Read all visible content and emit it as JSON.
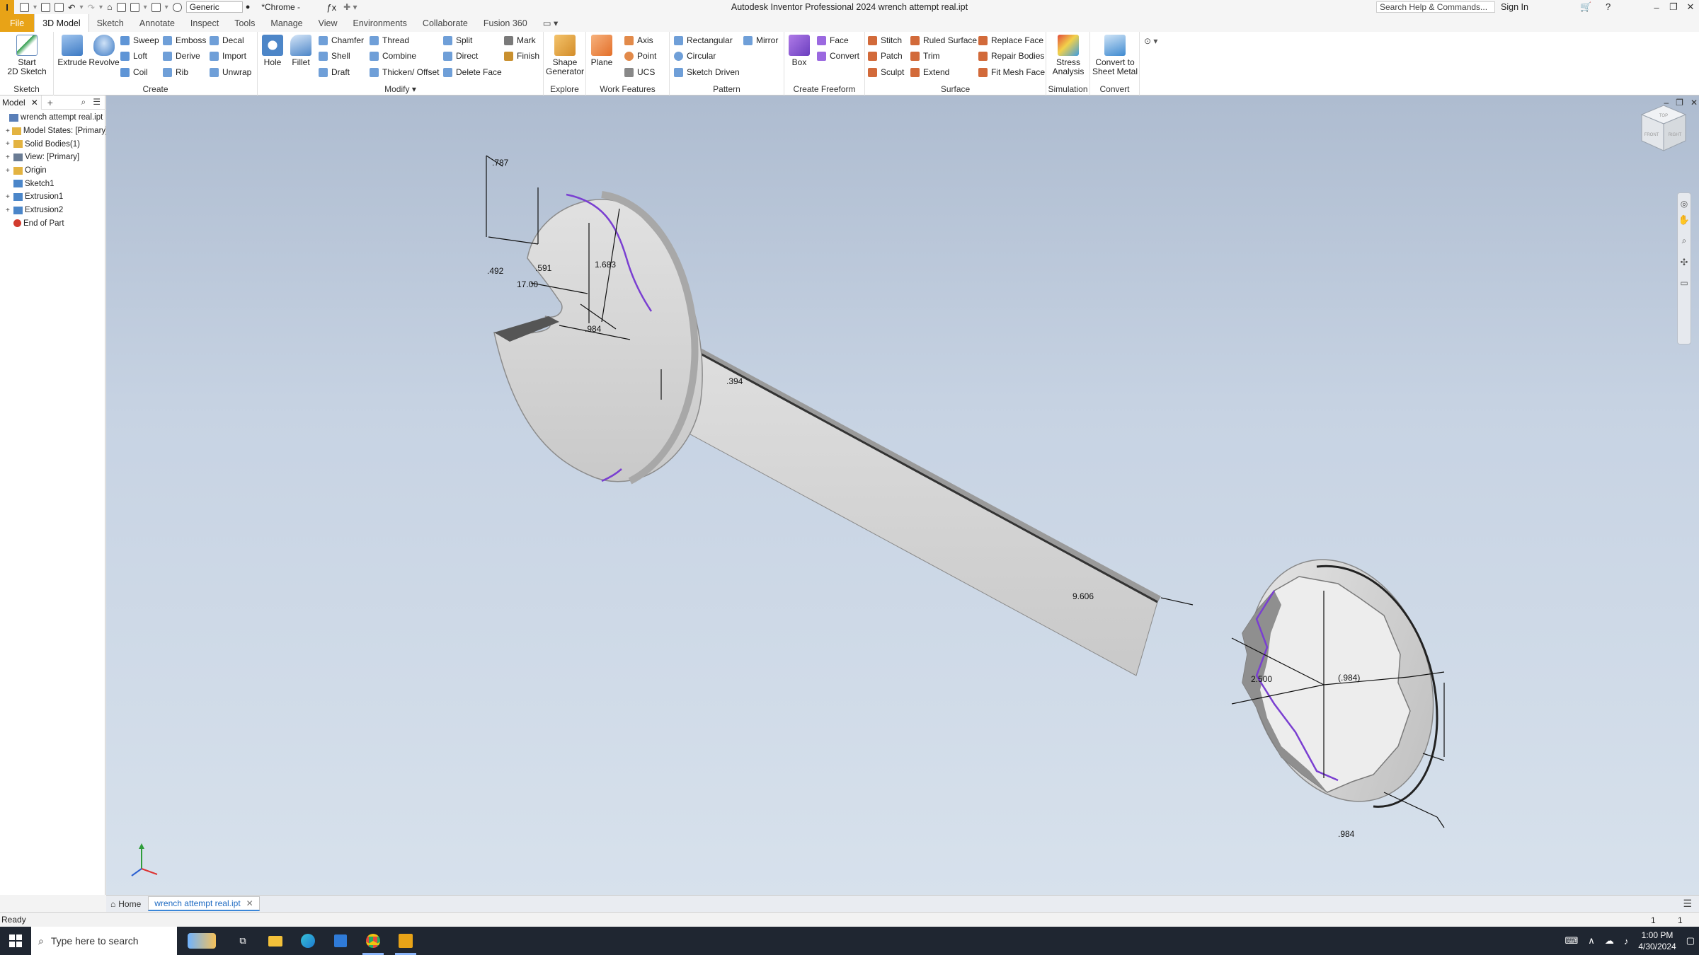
{
  "window": {
    "title": "Autodesk Inventor Professional 2024   wrench attempt real.ipt",
    "search_placeholder": "Search Help & Commands...",
    "sign_in": "Sign In",
    "appearance": "Generic",
    "browser_theme": "*Chrome -"
  },
  "menu": {
    "tabs": [
      "File",
      "3D Model",
      "Sketch",
      "Annotate",
      "Inspect",
      "Tools",
      "Manage",
      "View",
      "Environments",
      "Collaborate",
      "Fusion 360"
    ],
    "active": "3D Model"
  },
  "ribbon": {
    "sketch": {
      "label": "Sketch",
      "start": "Start\n2D Sketch"
    },
    "create": {
      "label": "Create",
      "extrude": "Extrude",
      "revolve": "Revolve",
      "sweep": "Sweep",
      "loft": "Loft",
      "coil": "Coil",
      "emboss": "Emboss",
      "derive": "Derive",
      "rib": "Rib",
      "decal": "Decal",
      "import": "Import",
      "unwrap": "Unwrap"
    },
    "modify": {
      "label": "Modify ▾",
      "hole": "Hole",
      "fillet": "Fillet",
      "chamfer": "Chamfer",
      "shell": "Shell",
      "draft": "Draft",
      "thread": "Thread",
      "combine": "Combine",
      "thicken": "Thicken/ Offset",
      "split": "Split",
      "direct": "Direct",
      "delete_face": "Delete Face",
      "mark": "Mark",
      "finish": "Finish"
    },
    "explore": {
      "label": "Explore",
      "shape_generator": "Shape\nGenerator"
    },
    "work_features": {
      "label": "Work Features",
      "plane": "Plane",
      "axis": "Axis",
      "point": "Point",
      "ucs": "UCS"
    },
    "pattern": {
      "label": "Pattern",
      "rectangular": "Rectangular",
      "circular": "Circular",
      "sketch_driven": "Sketch Driven",
      "mirror": "Mirror"
    },
    "freeform": {
      "label": "Create Freeform",
      "box": "Box",
      "face": "Face",
      "convert": "Convert"
    },
    "surface": {
      "label": "Surface",
      "stitch": "Stitch",
      "patch": "Patch",
      "sculpt": "Sculpt",
      "ruled_surface": "Ruled Surface",
      "trim": "Trim",
      "extend": "Extend",
      "replace_face": "Replace Face",
      "repair_bodies": "Repair Bodies",
      "fit_mesh_face": "Fit Mesh Face"
    },
    "simulation": {
      "label": "Simulation",
      "stress": "Stress\nAnalysis"
    },
    "convert": {
      "label": "Convert",
      "sheet_metal": "Convert to\nSheet Metal"
    }
  },
  "browser": {
    "tab": "Model",
    "nodes": [
      {
        "label": "wrench attempt real.ipt",
        "indent": 0,
        "expand": "",
        "icon": "part-icon",
        "color": "#5a7fb8"
      },
      {
        "label": "Model States: [Primary]",
        "indent": 1,
        "expand": "+",
        "icon": "folder-icon",
        "color": "#e3b341"
      },
      {
        "label": "Solid Bodies(1)",
        "indent": 1,
        "expand": "+",
        "icon": "folder-icon",
        "color": "#e3b341"
      },
      {
        "label": "View: [Primary]",
        "indent": 1,
        "expand": "+",
        "icon": "view-icon",
        "color": "#6a7c94"
      },
      {
        "label": "Origin",
        "indent": 1,
        "expand": "+",
        "icon": "folder-icon",
        "color": "#e3b341"
      },
      {
        "label": "Sketch1",
        "indent": 1,
        "expand": "",
        "icon": "sketch-icon",
        "color": "#4b86c9"
      },
      {
        "label": "Extrusion1",
        "indent": 1,
        "expand": "+",
        "icon": "extrude-icon",
        "color": "#4b86c9"
      },
      {
        "label": "Extrusion2",
        "indent": 1,
        "expand": "+",
        "icon": "extrude-icon",
        "color": "#4b86c9"
      },
      {
        "label": "End of Part",
        "indent": 1,
        "expand": "",
        "icon": "end-of-part-icon",
        "color": "#d23b2e"
      }
    ]
  },
  "dimensions": {
    "d787": ".787",
    "d492": ".492",
    "d591": ".591",
    "d1683": "1.683",
    "d1700": "17.00",
    "d984a": ".984",
    "d394": ".394",
    "d9606": "9.606",
    "d2500": "2.500",
    "d984p": "(.984)",
    "d984b": ".984"
  },
  "viewcube": {
    "top": "TOP",
    "front": "FRONT",
    "right": "RIGHT"
  },
  "doc_tabs": {
    "home": "Home",
    "document": "wrench attempt real.ipt"
  },
  "status": {
    "text": "Ready",
    "n1": "1",
    "n2": "1"
  },
  "taskbar": {
    "search": "Type here to search",
    "time": "1:00 PM",
    "date": "4/30/2024"
  },
  "colors": {
    "accent": "#e8a317",
    "sketch_line": "#7a3fd1",
    "viewport_top": "#aebcd0",
    "taskbar": "#1f2631"
  }
}
